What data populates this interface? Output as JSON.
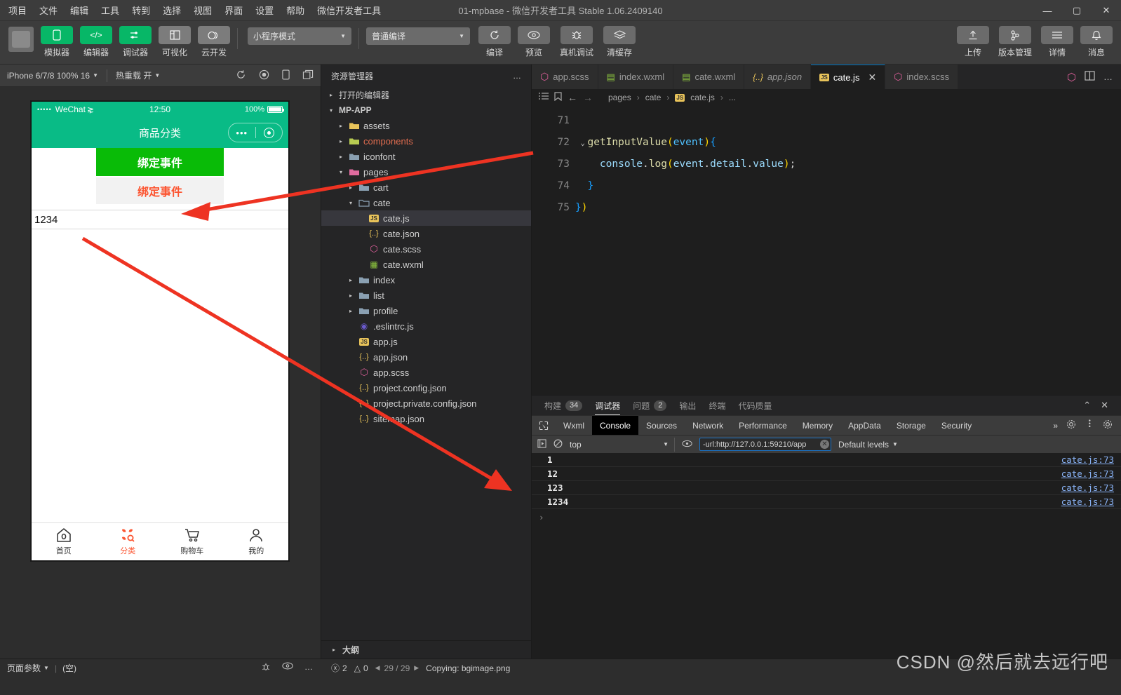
{
  "window": {
    "title": "01-mpbase  -  微信开发者工具 Stable 1.06.2409140",
    "minimize": "—",
    "maximize": "▢",
    "close": "✕"
  },
  "menu": [
    "项目",
    "文件",
    "编辑",
    "工具",
    "转到",
    "选择",
    "视图",
    "界面",
    "设置",
    "帮助",
    "微信开发者工具"
  ],
  "toolbar": {
    "mode_buttons": [
      {
        "label": "模拟器",
        "icon": "phone-icon",
        "glyph": "▯",
        "state": "green"
      },
      {
        "label": "编辑器",
        "icon": "code-icon",
        "glyph": "</>",
        "state": "green"
      },
      {
        "label": "调试器",
        "icon": "debugger-icon",
        "glyph": "⇄",
        "state": "green"
      },
      {
        "label": "可视化",
        "icon": "layout-icon",
        "glyph": "◫",
        "state": "gray"
      },
      {
        "label": "云开发",
        "icon": "cloud-icon",
        "glyph": "◯",
        "state": "gray"
      }
    ],
    "mode_select": "小程序模式",
    "compile_select": "普通编译",
    "action_buttons": [
      {
        "label": "编译",
        "icon": "refresh-icon",
        "glyph": "⟳"
      },
      {
        "label": "预览",
        "icon": "eye-icon",
        "glyph": "◉"
      },
      {
        "label": "真机调试",
        "icon": "bug-icon",
        "glyph": "🐞"
      },
      {
        "label": "清缓存",
        "icon": "layers-icon",
        "glyph": "≋"
      }
    ],
    "right_buttons": [
      {
        "label": "上传",
        "icon": "upload-icon",
        "glyph": "⬆"
      },
      {
        "label": "版本管理",
        "icon": "branch-icon",
        "glyph": "⑂"
      },
      {
        "label": "详情",
        "icon": "menu-icon",
        "glyph": "☰"
      },
      {
        "label": "消息",
        "icon": "bell-icon",
        "glyph": "🔔"
      }
    ]
  },
  "simulator": {
    "device": "iPhone 6/7/8 100% 16",
    "hot_reload": "热重载 开",
    "icons": [
      "refresh-icon",
      "record-icon",
      "rotate-icon",
      "window-icon"
    ],
    "status_bar": {
      "carrier": "WeChat",
      "dots": "•••••",
      "wifi": "⋧",
      "time": "12:50",
      "battery": "100%"
    },
    "nav_title": "商品分类",
    "buttons": [
      {
        "label": "绑定事件",
        "style": "primary"
      },
      {
        "label": "绑定事件",
        "style": "default"
      }
    ],
    "input_value": "1234",
    "tabbar": [
      {
        "label": "首页",
        "icon": "home-icon",
        "active": false
      },
      {
        "label": "分类",
        "icon": "category-icon",
        "active": true
      },
      {
        "label": "购物车",
        "icon": "cart-icon",
        "active": false
      },
      {
        "label": "我的",
        "icon": "user-icon",
        "active": false
      }
    ]
  },
  "explorer": {
    "title": "资源管理器",
    "more": "…",
    "open_editors": "打开的编辑器",
    "project": "MP-APP",
    "tree": [
      {
        "label": "assets",
        "type": "folder",
        "depth": 1,
        "twisty": "▸",
        "color": "#e8c35a"
      },
      {
        "label": "components",
        "type": "folder",
        "depth": 1,
        "twisty": "▸",
        "color": "#b8cc52",
        "labelColor": "#e06c4f"
      },
      {
        "label": "iconfont",
        "type": "folder",
        "depth": 1,
        "twisty": "▸",
        "color": "#8aa0b2"
      },
      {
        "label": "pages",
        "type": "folder",
        "depth": 1,
        "twisty": "▾",
        "color": "#e06c9f"
      },
      {
        "label": "cart",
        "type": "folder",
        "depth": 2,
        "twisty": "▸",
        "color": "#8aa0b2"
      },
      {
        "label": "cate",
        "type": "folder-open",
        "depth": 2,
        "twisty": "▾",
        "color": "#8aa0b2"
      },
      {
        "label": "cate.js",
        "type": "js",
        "depth": 3,
        "selected": true
      },
      {
        "label": "cate.json",
        "type": "json",
        "depth": 3
      },
      {
        "label": "cate.scss",
        "type": "scss",
        "depth": 3
      },
      {
        "label": "cate.wxml",
        "type": "wxml",
        "depth": 3
      },
      {
        "label": "index",
        "type": "folder",
        "depth": 2,
        "twisty": "▸",
        "color": "#8aa0b2"
      },
      {
        "label": "list",
        "type": "folder",
        "depth": 2,
        "twisty": "▸",
        "color": "#8aa0b2"
      },
      {
        "label": "profile",
        "type": "folder",
        "depth": 2,
        "twisty": "▸",
        "color": "#8aa0b2"
      },
      {
        "label": ".eslintrc.js",
        "type": "eslint",
        "depth": 2
      },
      {
        "label": "app.js",
        "type": "js",
        "depth": 2
      },
      {
        "label": "app.json",
        "type": "json",
        "depth": 2
      },
      {
        "label": "app.scss",
        "type": "scss",
        "depth": 2
      },
      {
        "label": "project.config.json",
        "type": "json",
        "depth": 2
      },
      {
        "label": "project.private.config.json",
        "type": "json",
        "depth": 2
      },
      {
        "label": "sitemap.json",
        "type": "json",
        "depth": 2
      }
    ],
    "outline": "大纲"
  },
  "editor": {
    "tabs": [
      {
        "label": "app.scss",
        "type": "scss",
        "active": false,
        "italic": false
      },
      {
        "label": "index.wxml",
        "type": "wxml",
        "active": false,
        "italic": false
      },
      {
        "label": "cate.wxml",
        "type": "wxml",
        "active": false,
        "italic": false
      },
      {
        "label": "app.json",
        "type": "json",
        "active": false,
        "italic": true
      },
      {
        "label": "cate.js",
        "type": "js",
        "active": true,
        "italic": false
      },
      {
        "label": "index.scss",
        "type": "scss",
        "active": false,
        "italic": false
      }
    ],
    "close_glyph": "✕",
    "tabs_right": [
      "scss-icon",
      "split-editor-icon",
      "more-icon"
    ],
    "breadcrumb": [
      "pages",
      "cate",
      "cate.js",
      "..."
    ],
    "breadcrumb_sep": "›",
    "nav_icons": [
      "outline-icon",
      "bookmark-icon",
      "back-icon",
      "forward-icon"
    ],
    "code": {
      "line_numbers": [
        "71",
        "72",
        "73",
        "74",
        "75"
      ],
      "lines": [
        "",
        "  getInputValue(event){",
        "      console.log(event.detail.value);",
        "  }",
        "})"
      ]
    }
  },
  "panel": {
    "tabs": [
      {
        "label": "构建",
        "badge": "34",
        "active": false
      },
      {
        "label": "调试器",
        "badge": "",
        "active": true
      },
      {
        "label": "问题",
        "badge": "2",
        "active": false
      },
      {
        "label": "输出",
        "badge": "",
        "active": false
      },
      {
        "label": "终端",
        "badge": "",
        "active": false
      },
      {
        "label": "代码质量",
        "badge": "",
        "active": false
      }
    ],
    "controls": [
      "collapse-icon",
      "close-icon"
    ],
    "devtools_tabs": [
      {
        "label": "Wxml",
        "active": false
      },
      {
        "label": "Console",
        "active": true
      },
      {
        "label": "Sources",
        "active": false
      },
      {
        "label": "Network",
        "active": false
      },
      {
        "label": "Performance",
        "active": false
      },
      {
        "label": "Memory",
        "active": false
      },
      {
        "label": "AppData",
        "active": false
      },
      {
        "label": "Storage",
        "active": false
      },
      {
        "label": "Security",
        "active": false
      }
    ],
    "devtools_more": "»",
    "devtools_right_icons": [
      "settings-icon",
      "kebab-icon",
      "gear-icon"
    ],
    "console_bar": {
      "context": "top",
      "filter_value": "-url:http://127.0.0.1:59210/app",
      "levels": "Default levels"
    },
    "console_rows": [
      {
        "message": "1",
        "source": "cate.js:73"
      },
      {
        "message": "12",
        "source": "cate.js:73"
      },
      {
        "message": "123",
        "source": "cate.js:73"
      },
      {
        "message": "1234",
        "source": "cate.js:73"
      }
    ],
    "prompt": "›"
  },
  "statusbar": {
    "page_params": "页面参数",
    "page_params_value": "(空)",
    "left_icons": [
      "bug-icon",
      "eye-icon",
      "more-icon"
    ],
    "errors": "2",
    "warnings": "0",
    "pagination": "29 / 29",
    "message": "Copying: bgimage.png"
  },
  "watermark": "CSDN @然后就去远行吧",
  "colors": {
    "brand_green": "#09bb86",
    "button_green": "#09bb07",
    "accent_orange": "#fc5531",
    "arrow_red": "#ee3322",
    "link_blue": "#8ab4f8"
  }
}
